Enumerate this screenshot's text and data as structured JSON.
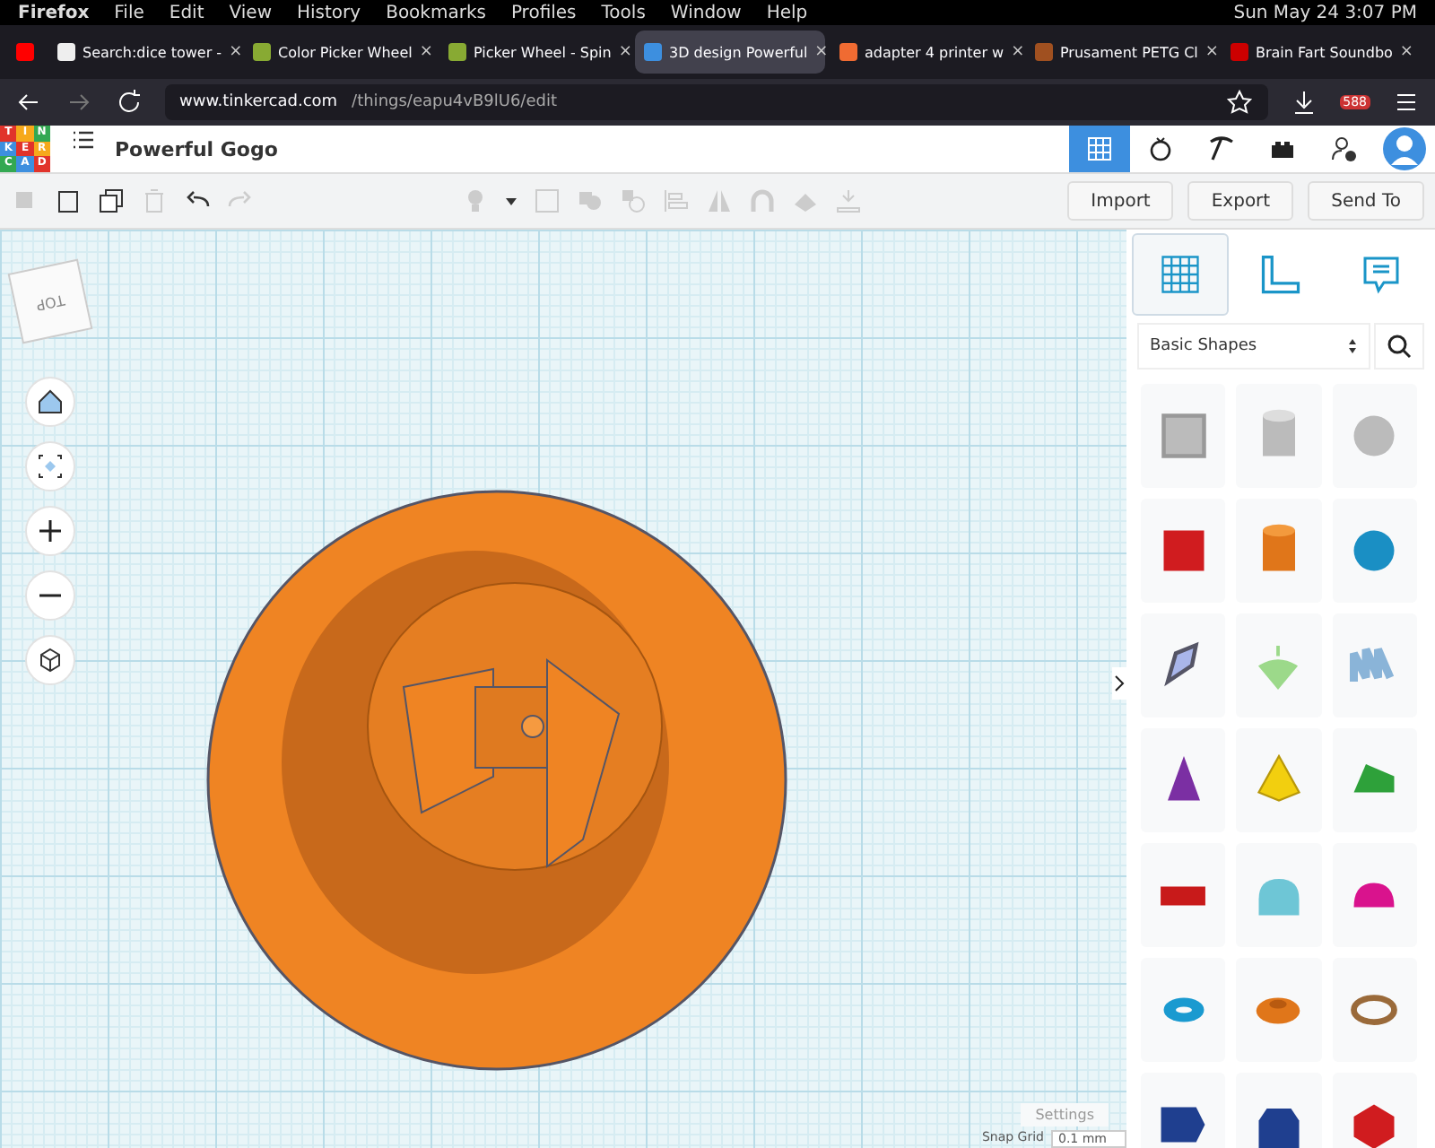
{
  "menu_bar": {
    "app": "Firefox",
    "items": [
      "File",
      "Edit",
      "View",
      "History",
      "Bookmarks",
      "Profiles",
      "Tools",
      "Window",
      "Help"
    ],
    "clock": "Sun May 24  3:07 PM"
  },
  "browser_tabs": [
    {
      "kind": "video",
      "selected": false
    },
    {
      "kind": "wiki",
      "label": "Search:dice tower -",
      "close": "×",
      "selected": false
    },
    {
      "kind": "wheel",
      "label": "Color Picker Wheel",
      "close": "×",
      "selected": false
    },
    {
      "kind": "wheel",
      "label": "Picker Wheel - Spin",
      "close": "×",
      "selected": false
    },
    {
      "kind": "tinker",
      "label": "3D design Powerful",
      "close": "×",
      "selected": true
    },
    {
      "kind": "orange",
      "label": "adapter 4 printer w",
      "close": "×",
      "selected": false
    },
    {
      "kind": "prusa",
      "label": "Prusament PETG Cl",
      "close": "×",
      "selected": false
    },
    {
      "kind": "red",
      "label": "Brain Fart Soundbo",
      "close": "×",
      "selected": false
    }
  ],
  "address_bar": {
    "domain": "www.tinkercad.com",
    "path": "/things/eapu4vB9lU6/edit"
  },
  "extension_badge": "588",
  "app_header": {
    "logo_letters": [
      [
        "T",
        "I",
        "N"
      ],
      [
        "K",
        "E",
        "R"
      ],
      [
        "C",
        "A",
        "D"
      ]
    ],
    "design_title": "Powerful Gogo",
    "views": [
      {
        "kind": "grid",
        "selected": true
      },
      {
        "kind": "blocks",
        "selected": false
      },
      {
        "kind": "pickaxe",
        "selected": false
      },
      {
        "kind": "brick",
        "selected": false
      }
    ]
  },
  "toolbar": {
    "buttons": [
      "Import",
      "Export",
      "Send To"
    ]
  },
  "view_cube": "TOP",
  "panel": {
    "tools": [
      {
        "kind": "workplane",
        "selected": true
      },
      {
        "kind": "ruler",
        "selected": false
      },
      {
        "kind": "notes",
        "selected": false
      }
    ],
    "category": "Basic Shapes"
  },
  "settings": {
    "label": "Settings",
    "snap_label": "Snap Grid",
    "snap_value": "0.1 mm"
  }
}
